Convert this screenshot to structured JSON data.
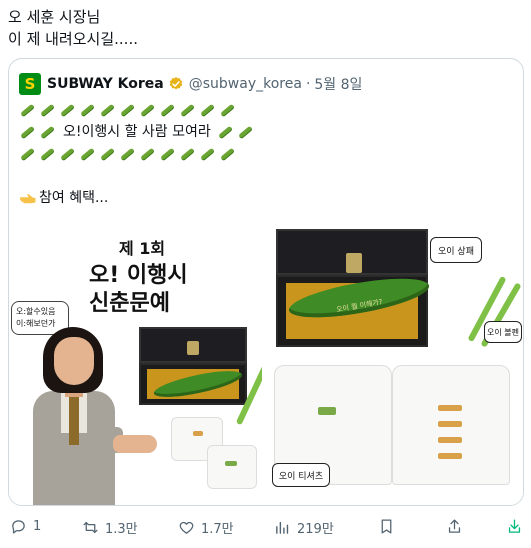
{
  "tweet": {
    "line1": "오 세훈 시장님",
    "line2": "이 제 내려오시길....."
  },
  "quote": {
    "avatar_letter": "S",
    "name": "SUBWAY Korea",
    "handle": "@subway_korea",
    "date": "5월 8일",
    "headline": "오!이행시 할 사람 모여라",
    "benefit": "참여 혜택...",
    "icons": {
      "avatar": "subway-logo",
      "verified": "gold-checkmark-icon",
      "cucumber": "cucumber-emoji",
      "pointing": "pointing-hand-emoji"
    }
  },
  "media": {
    "poster": {
      "title1": "제 1회",
      "title2": "오! 이행시",
      "title3": "신춘문예",
      "bubble_line1": "오:할수있음",
      "bubble_line2": "이:해보던가"
    },
    "prizes": {
      "trophy_label": "오이 상패",
      "pen_label": "오이 볼펜",
      "shirt_label": "오이 티셔츠",
      "cucumber_engraving": "오이 뭘 이해가?"
    }
  },
  "actions": {
    "reply_count": "1",
    "retweet_count": "1.3만",
    "like_count": "1.7만",
    "views_count": "219만"
  },
  "colors": {
    "text": "#0f1419",
    "secondary": "#536471",
    "border": "#cfd9de",
    "subway_green": "#008c15",
    "subway_yellow": "#ffd400"
  }
}
